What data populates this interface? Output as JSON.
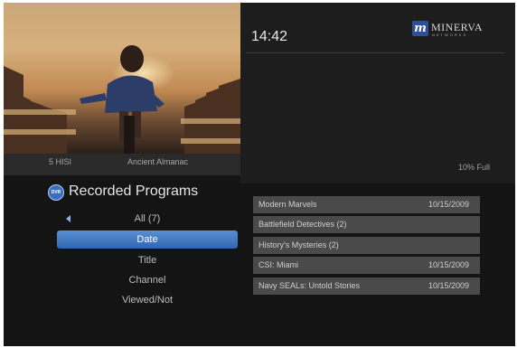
{
  "colors": {
    "background": "#141414",
    "selection": "#3d76c2",
    "row": "#4a4a4a",
    "brand": "#2f4f9b"
  },
  "preview": {
    "channel": "5  HISI",
    "program": "Ancient Almanac"
  },
  "header": {
    "time": "14:42",
    "logo_mark": "m",
    "logo_text": "MINERVA",
    "logo_sub": "NETWORKS"
  },
  "storage": {
    "label": "10% Full",
    "percent": 10
  },
  "menu": {
    "icon_text": "DVR",
    "title": "Recorded Programs",
    "items": [
      {
        "label": "All (7)",
        "selected": false
      },
      {
        "label": "Date",
        "selected": true
      },
      {
        "label": "Title",
        "selected": false
      },
      {
        "label": "Channel",
        "selected": false
      },
      {
        "label": "Viewed/Not",
        "selected": false
      }
    ]
  },
  "programs": [
    {
      "title": "Modern Marvels",
      "date": "10/15/2009"
    },
    {
      "title": "Battlefield Detectives (2)",
      "date": ""
    },
    {
      "title": "History's Mysteries (2)",
      "date": ""
    },
    {
      "title": "CSI: Miami",
      "date": "10/15/2009"
    },
    {
      "title": "Navy SEALs: Untold Stories",
      "date": "10/15/2009"
    }
  ]
}
